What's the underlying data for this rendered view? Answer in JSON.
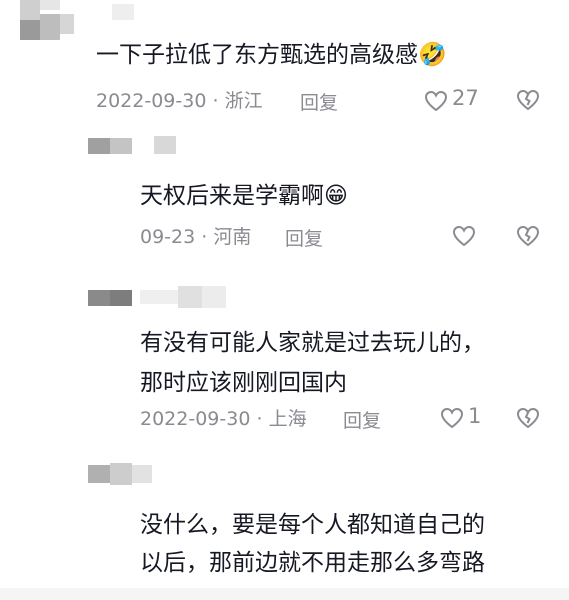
{
  "comments": [
    {
      "text": "一下子拉低了东方甄选的高级感",
      "emoji": "🤣",
      "date": "2022-09-30",
      "separator": "·",
      "location": "浙江",
      "reply_label": "回复",
      "likes": "27"
    },
    {
      "text": "天权后来是学霸啊",
      "emoji": "😁",
      "date": "09-23",
      "separator": "·",
      "location": "河南",
      "reply_label": "回复",
      "likes": ""
    },
    {
      "text_line1": "有没有可能人家就是过去玩儿的，",
      "text_line2": "那时应该刚刚回国内",
      "date": "2022-09-30",
      "separator": "·",
      "location": "上海",
      "reply_label": "回复",
      "likes": "1"
    },
    {
      "text_line1": "没什么，要是每个人都知道自己的",
      "text_line2": "以后，那前边就不用走那么多弯路"
    }
  ]
}
